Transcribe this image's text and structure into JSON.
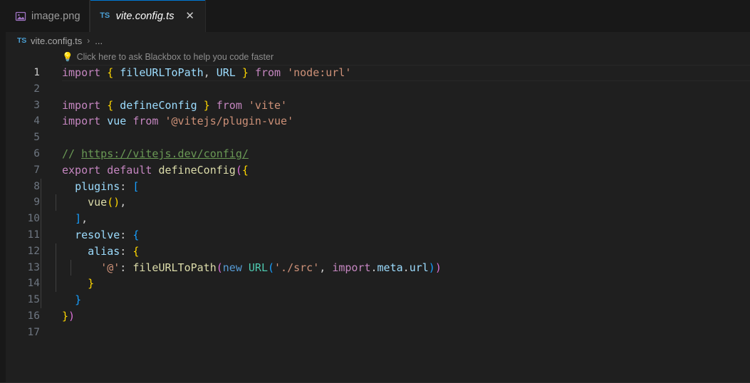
{
  "window": {
    "bg": "#1f1f1f",
    "tabbar_bg": "#181818",
    "accent": "#0078d4"
  },
  "tabs": [
    {
      "label": "image.png",
      "icon": "image-file-icon",
      "active": false,
      "icon_color": "#a074c4"
    },
    {
      "label": "vite.config.ts",
      "icon": "typescript-file-icon",
      "badge": "TS",
      "active": true,
      "close_glyph": "✕",
      "icon_color": "#4a9fd4"
    }
  ],
  "breadcrumb": {
    "badge": "TS",
    "file": "vite.config.ts",
    "separator": "›",
    "ellipsis": "..."
  },
  "codelens": {
    "icon": "lightbulb-icon",
    "glyph": "💡",
    "text": "Click here to ask Blackbox to help you code faster"
  },
  "editor": {
    "language": "typescript",
    "first_line": 1,
    "last_line": 17,
    "active_line": 1,
    "lines": [
      {
        "n": "1",
        "text": "import { fileURLToPath, URL } from 'node:url'"
      },
      {
        "n": "2",
        "text": ""
      },
      {
        "n": "3",
        "text": "import { defineConfig } from 'vite'"
      },
      {
        "n": "4",
        "text": "import vue from '@vitejs/plugin-vue'"
      },
      {
        "n": "5",
        "text": ""
      },
      {
        "n": "6",
        "text": "// https://vitejs.dev/config/"
      },
      {
        "n": "7",
        "text": "export default defineConfig({"
      },
      {
        "n": "8",
        "text": "  plugins: ["
      },
      {
        "n": "9",
        "text": "    vue(),"
      },
      {
        "n": "10",
        "text": "  ],"
      },
      {
        "n": "11",
        "text": "  resolve: {"
      },
      {
        "n": "12",
        "text": "    alias: {"
      },
      {
        "n": "13",
        "text": "      '@': fileURLToPath(new URL('./src', import.meta.url))"
      },
      {
        "n": "14",
        "text": "    }"
      },
      {
        "n": "15",
        "text": "  }"
      },
      {
        "n": "16",
        "text": "})"
      },
      {
        "n": "17",
        "text": ""
      }
    ],
    "tokens": {
      "keyword": "#c586c0",
      "control": "#569cd6",
      "variable": "#9cdcfe",
      "function": "#dcdcaa",
      "type": "#4ec9b0",
      "string": "#ce9178",
      "comment": "#6a9955",
      "bracket1": "#ffd700",
      "bracket2": "#da70d6",
      "bracket3": "#179fff",
      "plain": "#cccccc"
    }
  }
}
